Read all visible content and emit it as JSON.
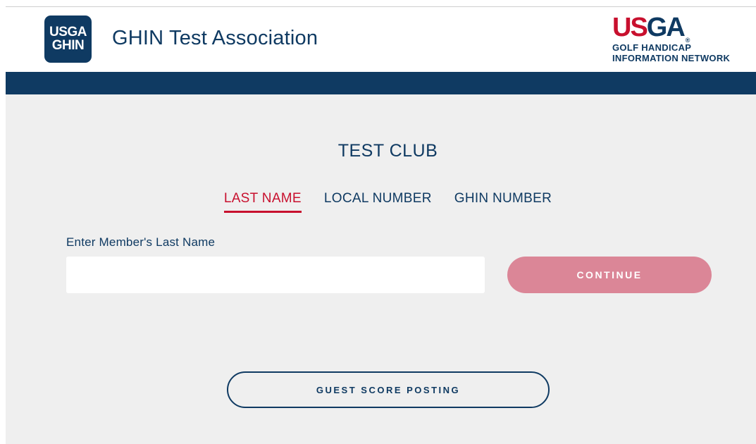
{
  "header": {
    "app_logo_line1": "USGA",
    "app_logo_line2": "GHIN",
    "title": "GHIN Test Association",
    "brand_logo": {
      "word_red": "US",
      "word_blue": "GA",
      "registered": "®",
      "tagline_line1": "GOLF HANDICAP",
      "tagline_line2": "INFORMATION NETWORK"
    }
  },
  "main": {
    "club_name": "TEST CLUB",
    "tabs": [
      {
        "label": "LAST NAME",
        "active": true
      },
      {
        "label": "LOCAL NUMBER",
        "active": false
      },
      {
        "label": "GHIN NUMBER",
        "active": false
      }
    ],
    "search": {
      "label": "Enter Member's Last Name",
      "value": "",
      "placeholder": ""
    },
    "continue_label": "CONTINUE",
    "guest_label": "GUEST SCORE POSTING"
  },
  "colors": {
    "navy": "#0f3a62",
    "red": "#c8102e",
    "continue_disabled": "#db8697",
    "background": "#efefef"
  }
}
